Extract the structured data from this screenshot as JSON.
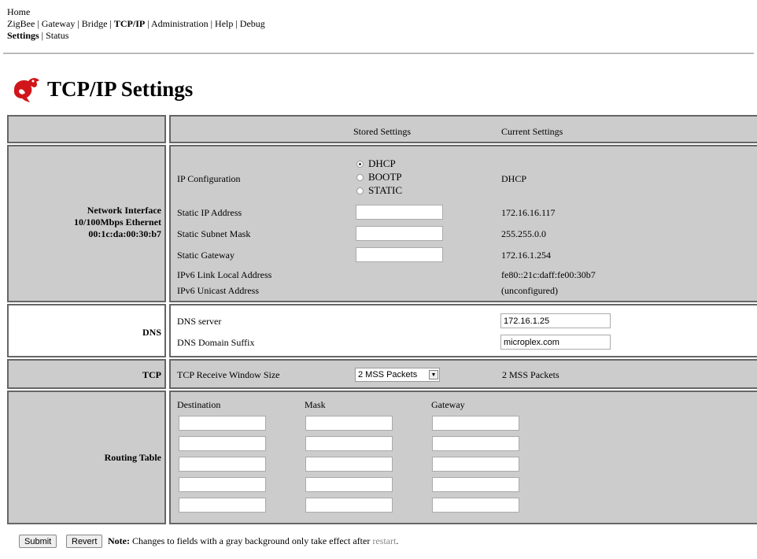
{
  "nav": {
    "line1": [
      "Home"
    ],
    "line2": [
      "ZigBee",
      "Gateway",
      "Bridge",
      "TCP/IP",
      "Administration",
      "Help",
      "Debug"
    ],
    "line3": [
      "Settings",
      "Status"
    ]
  },
  "page": {
    "title": "TCP/IP Settings"
  },
  "header": {
    "stored": "Stored Settings",
    "current": "Current Settings"
  },
  "network": {
    "label_lines": [
      "Network Interface",
      "10/100Mbps Ethernet",
      "00:1c:da:00:30:b7"
    ],
    "ip_config_label": "IP Configuration",
    "ip_options": [
      "DHCP",
      "BOOTP",
      "STATIC"
    ],
    "ip_selected": "DHCP",
    "ip_current": "DHCP",
    "static_ip_label": "Static IP Address",
    "static_ip_value": "",
    "static_ip_current": "172.16.16.117",
    "subnet_label": "Static Subnet Mask",
    "subnet_value": "",
    "subnet_current": "255.255.0.0",
    "gateway_label": "Static Gateway",
    "gateway_value": "",
    "gateway_current": "172.16.1.254",
    "ipv6_link_label": "IPv6 Link Local Address",
    "ipv6_link_current": "fe80::21c:daff:fe00:30b7",
    "ipv6_unicast_label": "IPv6 Unicast Address",
    "ipv6_unicast_current": "(unconfigured)"
  },
  "dns": {
    "label": "DNS",
    "server_label": "DNS server",
    "server_value": "172.16.1.25",
    "suffix_label": "DNS Domain Suffix",
    "suffix_value": "microplex.com"
  },
  "tcp": {
    "label": "TCP",
    "window_label": "TCP Receive Window Size",
    "window_selected": "2 MSS Packets",
    "window_current": "2 MSS Packets"
  },
  "routing": {
    "label": "Routing Table",
    "col_destination": "Destination",
    "col_mask": "Mask",
    "col_gateway": "Gateway"
  },
  "footer": {
    "submit": "Submit",
    "revert": "Revert",
    "note_bold": "Note:",
    "note_text": " Changes to fields with a gray background only take effect after ",
    "restart": "restart",
    "period": "."
  }
}
